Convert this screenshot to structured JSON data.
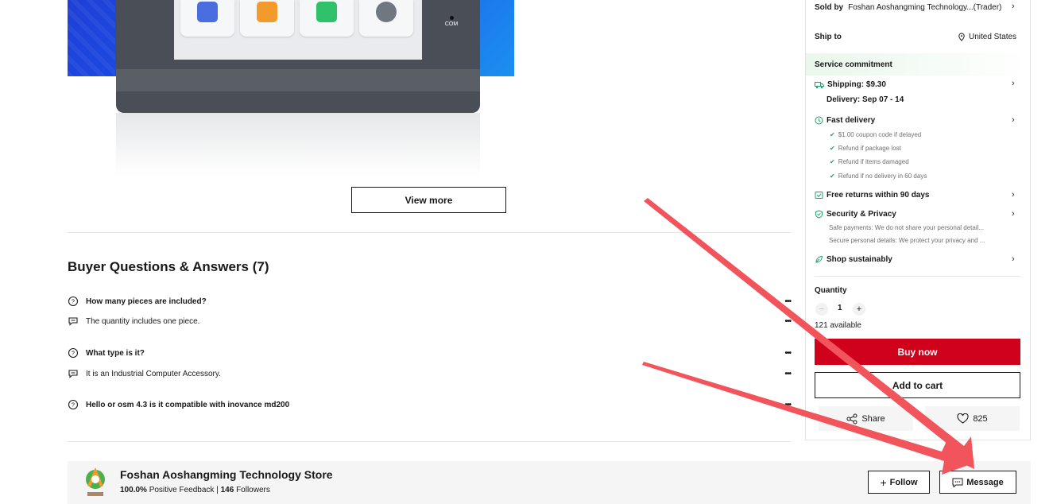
{
  "product_image": {
    "com_label": "COM"
  },
  "view_more_label": "View more",
  "qa": {
    "title": "Buyer Questions & Answers (7)",
    "items": [
      {
        "question": "How many pieces are included?",
        "answer": "The quantity includes one piece."
      },
      {
        "question": "What type is it?",
        "answer": "It is an Industrial Computer Accessory."
      },
      {
        "question": "Hello or osm 4.3 is it compatible with inovance md200",
        "answer": ""
      }
    ],
    "more_glyph": "•••"
  },
  "panel": {
    "sold_by_label": "Sold by",
    "sold_by_value": "Foshan Aoshangming Technology...(Trader)",
    "ship_to_label": "Ship to",
    "ship_to_value": "United States",
    "service_title": "Service commitment",
    "shipping": "Shipping: $9.30",
    "delivery": "Delivery: Sep 07 - 14",
    "fast_delivery": "Fast delivery",
    "fast_bullets": [
      "$1.00 coupon code if delayed",
      "Refund if package lost",
      "Refund if items damaged",
      "Refund if no delivery in 60 days"
    ],
    "free_returns": "Free returns within 90 days",
    "security": "Security & Privacy",
    "security_lines": [
      "Safe payments: We do not share your personal detail...",
      "Secure personal details: We protect your privacy and ..."
    ],
    "sustainably": "Shop sustainably",
    "quantity_label": "Quantity",
    "quantity_value": "1",
    "minus": "−",
    "plus": "+",
    "available": "121 available",
    "buy_now": "Buy now",
    "add_to_cart": "Add to cart",
    "share": "Share",
    "wishlist_count": "825",
    "chevron": "›"
  },
  "store": {
    "name": "Foshan Aoshangming Technology Store",
    "positive_value": "100.0%",
    "positive_label": "Positive Feedback",
    "separator": "|",
    "followers_value": "146",
    "followers_label": "Followers",
    "follow": "Follow",
    "message": "Message"
  },
  "colors": {
    "buy_now": "#d0021b",
    "accent_green": "#22a06b",
    "arrow": "#f2545b",
    "app_blue": "#4a6ee0",
    "app_orange": "#f39a2c",
    "app_green": "#2fc26a",
    "app_grey": "#707780"
  },
  "icons": [
    "question-icon",
    "answer-icon",
    "more-icon",
    "location-icon",
    "truck-icon",
    "clock-icon",
    "return-icon",
    "shield-icon",
    "leaf-icon",
    "share-icon",
    "heart-icon",
    "plus-icon",
    "message-icon",
    "store-logo-icon",
    "arrow-annotation"
  ]
}
